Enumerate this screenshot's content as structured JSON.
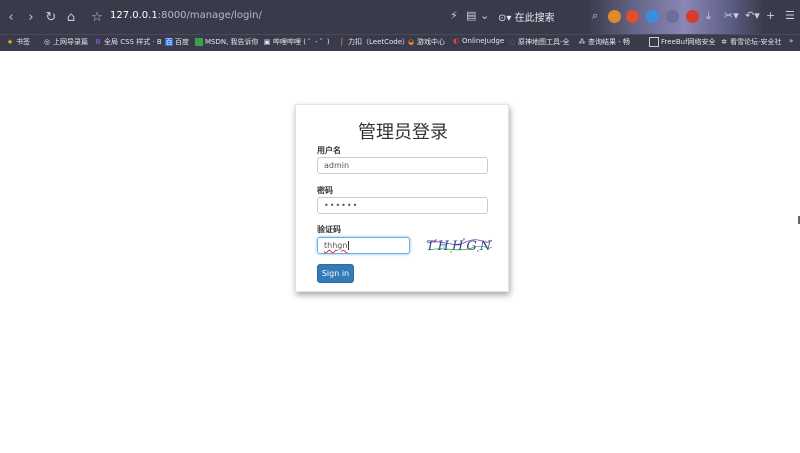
{
  "browser": {
    "url_host": "127.0.0.1",
    "url_path": ":8000/manage/login/",
    "search_label": "在此搜索",
    "bookmarks": [
      "书签",
      "上网导录篇",
      "全局 CSS 样式 · B",
      "百度",
      "MSDN, 我告诉你",
      "哔哩哔哩 ( ゜- ゜)",
      "力扣（LeetCode）",
      "游戏中心",
      "OnlineJudge",
      "原神地图工具-全",
      "查询结果 - 畅",
      "FreeBuf网络安全",
      "看雪论坛-安全社"
    ]
  },
  "login": {
    "title": "管理员登录",
    "username_label": "用户名",
    "username_value": "admin",
    "password_label": "密码",
    "password_value": "••••••",
    "captcha_label": "验证码",
    "captcha_value": "thhgn",
    "captcha_image_text": "THHGN",
    "signin_label": "Sign in"
  },
  "colors": {
    "accent": "#337ab7",
    "chrome": "#3a3b4a"
  }
}
